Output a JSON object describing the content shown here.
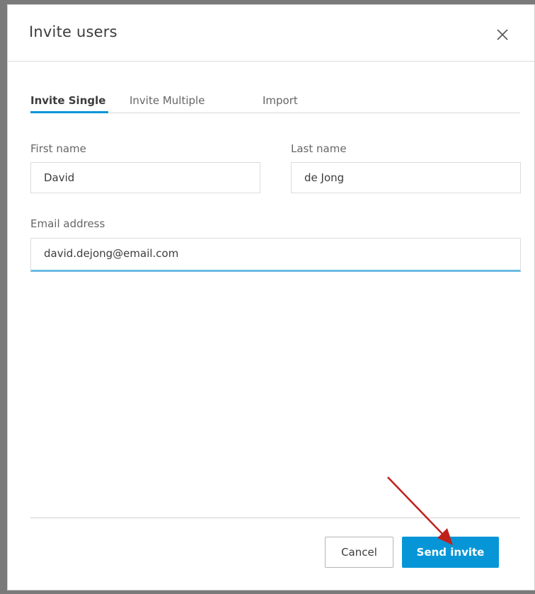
{
  "dialog": {
    "title": "Invite users"
  },
  "tabs": [
    {
      "label": "Invite Single",
      "active": true
    },
    {
      "label": "Invite Multiple",
      "active": false
    },
    {
      "label": "Import",
      "active": false
    }
  ],
  "form": {
    "first_name_label": "First name",
    "first_name_value": "David",
    "last_name_label": "Last name",
    "last_name_value": "de Jong",
    "email_label": "Email address",
    "email_value": "david.dejong@email.com"
  },
  "footer": {
    "cancel_label": "Cancel",
    "send_label": "Send invite"
  },
  "colors": {
    "accent": "#0696d7",
    "annotation_arrow": "#c0201c"
  },
  "icons": {
    "close": "close-icon"
  }
}
